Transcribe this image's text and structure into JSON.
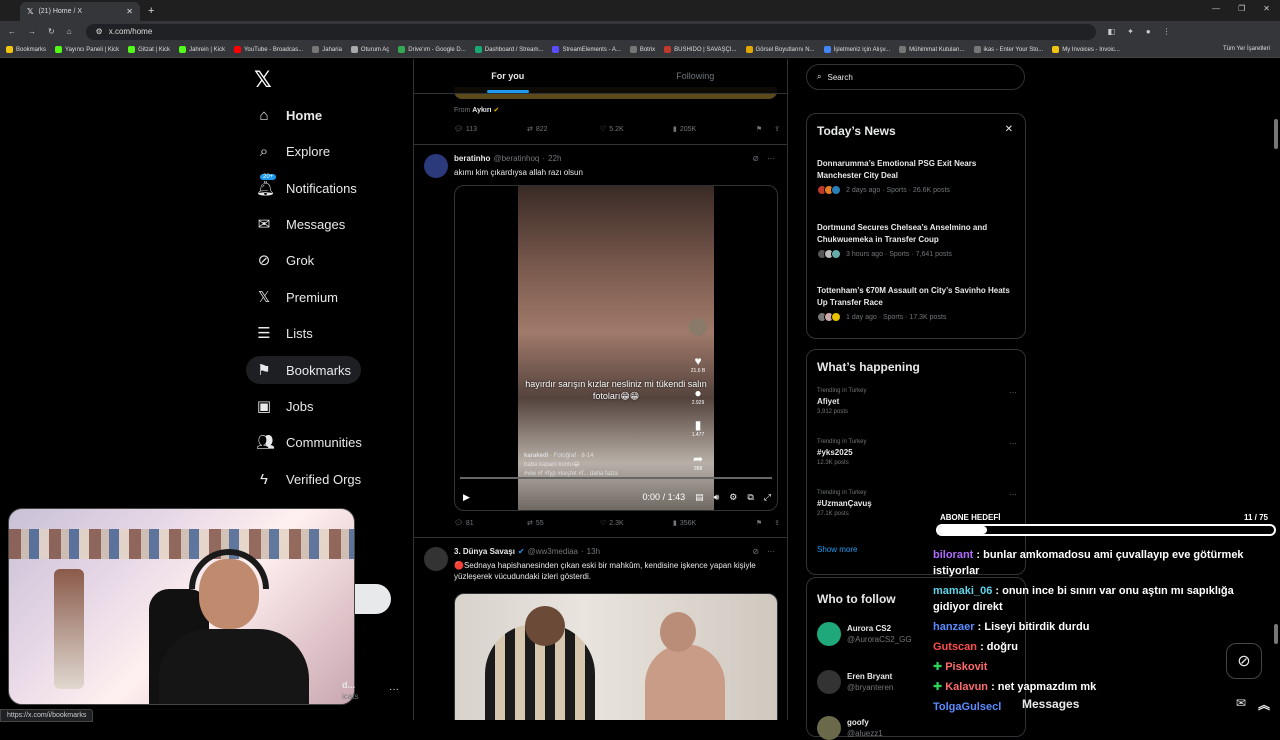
{
  "browser": {
    "tab_title": "(21) Home / X",
    "url": "x.com/home",
    "status_url": "https://x.com/i/bookmarks",
    "bookmarks": [
      "Bookmarks",
      "Yayıncı Paneli | Kick",
      "Gitzat | Kick",
      "Jahrein | Kick",
      "YouTube - Broadcas...",
      "Jaharia",
      "Oturum Aç",
      "Drive'ım - Google D...",
      "Dashboard / Stream...",
      "StreamElements - A...",
      "Botrix",
      "BUSHIDO | SAVAŞÇI...",
      "Görsel Boyutlarını N...",
      "İşletmeniz için Alışv...",
      "Mühimmat Kutuları...",
      "ikas - Enter Your Sto...",
      "My Invoices - Invoic..."
    ],
    "bookmarks_right": "Tüm Yer İşaretleri"
  },
  "nav": {
    "notification_badge": "20+",
    "items": [
      {
        "label": "Home",
        "icon": "home-icon"
      },
      {
        "label": "Explore",
        "icon": "search-icon"
      },
      {
        "label": "Notifications",
        "icon": "bell-icon"
      },
      {
        "label": "Messages",
        "icon": "envelope-icon"
      },
      {
        "label": "Grok",
        "icon": "grok-icon"
      },
      {
        "label": "Premium",
        "icon": "x-icon"
      },
      {
        "label": "Lists",
        "icon": "list-icon"
      },
      {
        "label": "Bookmarks",
        "icon": "bookmark-icon"
      },
      {
        "label": "Jobs",
        "icon": "briefcase-icon"
      },
      {
        "label": "Communities",
        "icon": "people-icon"
      },
      {
        "label": "Verified Orgs",
        "icon": "lightning-icon"
      }
    ],
    "account_name": "d...",
    "account_handle": "icats"
  },
  "feed": {
    "tabs": [
      "For you",
      "Following"
    ],
    "prev": {
      "from_label": "From",
      "from_name": "Aykırı",
      "replies": "113",
      "reposts": "822",
      "likes": "5.2K",
      "views": "205K"
    },
    "tweet1": {
      "name": "beratinho",
      "handle": "@beratinhoq",
      "time": "22h",
      "text": "akımı kim çıkardıysa allah razı olsun",
      "video_caption": "hayırdır sarışın kızlar nesliniz mi tükendi salın fotoları😁😁",
      "video_likes": "21,6 B",
      "video_comments": "2.929",
      "video_saves": "1.477",
      "video_shares": "958",
      "video_user": "karakedi",
      "video_photo": "Fotoğraf",
      "video_date": "8-14",
      "video_desc": "baba kapani kuntu😂",
      "video_tags": "#viw #f #fyp  #keşfet #f... daha fazla",
      "video_time": "0:00 / 1:43",
      "replies": "81",
      "reposts": "55",
      "likes": "2.3K",
      "views": "356K"
    },
    "tweet2": {
      "name": "3. Dünya Savaşı",
      "handle": "@ww3mediaa",
      "time": "13h",
      "text": "🔴Sednaya hapishanesinden çıkan eski bir mahkûm, kendisine işkence yapan kişiyle yüzleşerek vücudundaki izleri gösterdi."
    }
  },
  "right": {
    "search_placeholder": "Search",
    "news_title": "Today’s News",
    "news": [
      {
        "title": "Donnarumma’s Emotional PSG Exit Nears Manchester City Deal",
        "meta": "2 days ago · Sports · 26.6K posts"
      },
      {
        "title": "Dortmund Secures Chelsea’s Anselmino and Chukwuemeka in Transfer Coup",
        "meta": "3 hours ago · Sports · 7,641 posts"
      },
      {
        "title": "Tottenham’s €70M Assault on City’s Savinho Heats Up Transfer Race",
        "meta": "1 day ago · Sports · 17.3K posts"
      }
    ],
    "happening_title": "What’s happening",
    "trends": [
      {
        "sub": "Trending in Turkey",
        "name": "Afiyet",
        "count": "3,912 posts"
      },
      {
        "sub": "Trending in Turkey",
        "name": "#yks2025",
        "count": "12.3K posts"
      },
      {
        "sub": "Trending in Turkey",
        "name": "#UzmanÇavuş",
        "count": "27.1K posts"
      }
    ],
    "show_more": "Show more",
    "wtf_title": "Who to follow",
    "follow": [
      {
        "name": "Aurora CS2",
        "handle": "@AuroraCS2_GG"
      },
      {
        "name": "Eren Bryant",
        "handle": "@bryanteren"
      },
      {
        "name": "goofy",
        "handle": "@aluezz1"
      }
    ]
  },
  "overlay": {
    "goal_label": "ABONE HEDEFİ",
    "goal_count": "11 / 75",
    "goal_fraction": 0.147,
    "chat": [
      {
        "user": "bilorant",
        "color": "#b06cff",
        "text": "bunlar amkomadosu ami çuvallayıp eve götürmek istiyorlar",
        "plus": false
      },
      {
        "user": "mamaki_06",
        "color": "#5fd3e8",
        "text": "onun ince bi sınırı var onu aştın mı sapıklığa gidiyor direkt",
        "plus": false
      },
      {
        "user": "hanzaer",
        "color": "#5a8cff",
        "text": "Liseyi bitirdik durdu",
        "plus": false
      },
      {
        "user": "Gutscan",
        "color": "#ff4d4d",
        "text": "doğru",
        "plus": false
      },
      {
        "user": "Piskovit",
        "color": "#ff6b6b",
        "text": "",
        "plus": true
      },
      {
        "user": "Kalavun",
        "color": "#ff6b6b",
        "text": "net yapmazdım mk",
        "plus": true
      },
      {
        "user": "TolgaGulsecl",
        "color": "#5a8cff",
        "text": "",
        "plus": false
      }
    ],
    "messages_label": "Messages"
  }
}
